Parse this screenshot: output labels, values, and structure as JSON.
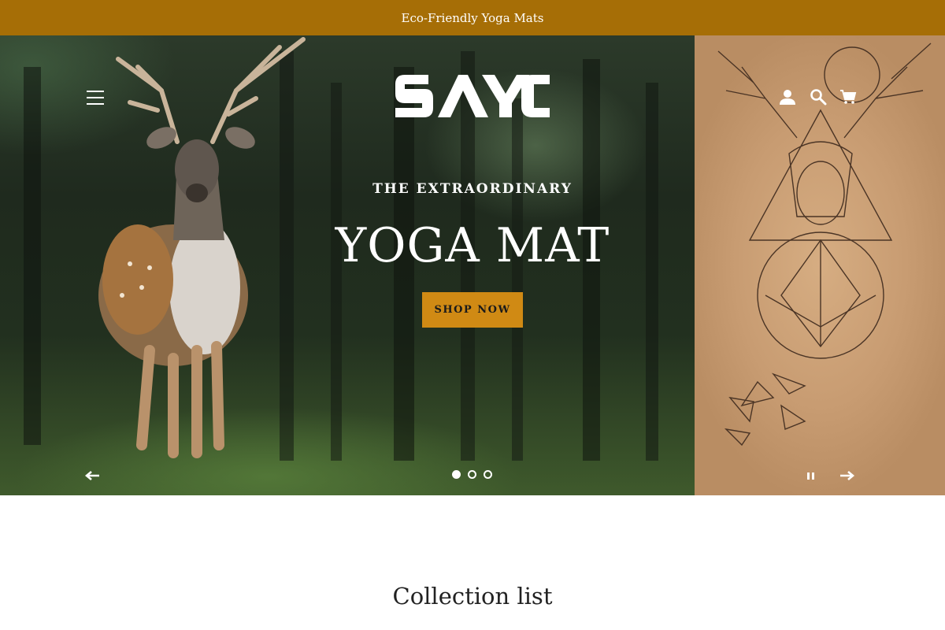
{
  "announcement": {
    "text": "Eco-Friendly Yoga Mats"
  },
  "header": {
    "logo_text": "SAYO",
    "menu_icon": "hamburger-menu-icon",
    "account_icon": "user-icon",
    "search_icon": "search-icon",
    "cart_icon": "cart-icon"
  },
  "hero": {
    "eyebrow": "THE EXTRAORDINARY",
    "headline": "YOGA MAT",
    "cta_label": "SHOP NOW",
    "cta_color": "#d08a14",
    "slides": {
      "count": 3,
      "active": 1
    },
    "prev_icon": "arrow-left-icon",
    "next_icon": "arrow-right-icon",
    "pause_icon": "pause-icon"
  },
  "collection": {
    "title": "Collection list"
  },
  "colors": {
    "announcement_bg": "#a66e06",
    "text_light": "#ffffff"
  }
}
